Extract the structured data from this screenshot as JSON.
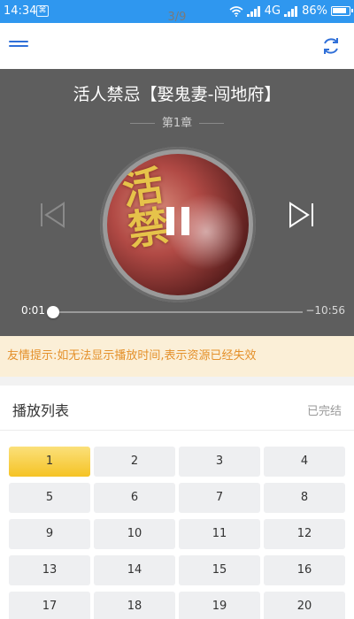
{
  "status_bar": {
    "time": "14:34",
    "network": "4G",
    "battery": "86%"
  },
  "page_indicator": "3/9",
  "player": {
    "title": "活人禁忌【娶鬼妻-闯地府】",
    "chapter": "第1章",
    "current_time": "0:01",
    "remaining_time": "−10:56",
    "progress": 0.002,
    "state": "playing"
  },
  "tip": "友情提示:如无法显示播放时间,表示资源已经失效",
  "playlist": {
    "title": "播放列表",
    "status": "已完结",
    "active_episode": "1",
    "episodes": [
      "1",
      "2",
      "3",
      "4",
      "5",
      "6",
      "7",
      "8",
      "9",
      "10",
      "11",
      "12",
      "13",
      "14",
      "15",
      "16",
      "17",
      "18",
      "19",
      "20"
    ]
  },
  "colors": {
    "status_bar": "#2f97ef",
    "player_bg": "#5e5e5e",
    "tip_bg": "#fbefd7",
    "tip_text": "#e4902a",
    "active_episode": "#f5c325"
  },
  "icons": {
    "menu": "menu-icon",
    "refresh": "refresh-icon",
    "prev": "skip-previous-icon",
    "next": "skip-next-icon",
    "pause": "pause-icon"
  }
}
